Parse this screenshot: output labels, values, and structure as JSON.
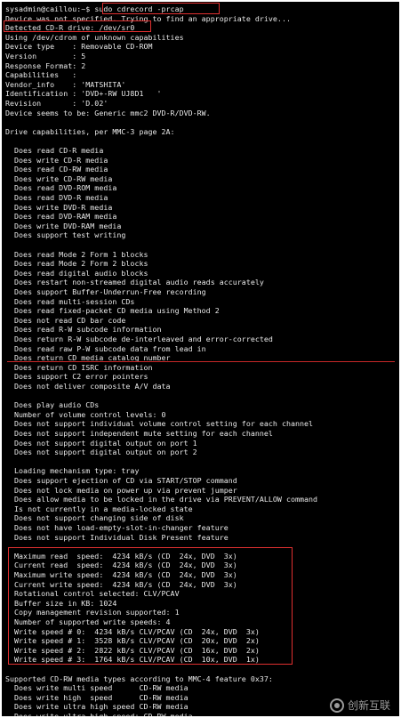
{
  "prompt": "sysadmin@caillou:~$ ",
  "command": "sudo cdrecord -prcap",
  "detected_line": "Detected CD-R drive: /dev/sr0",
  "lines": [
    "Device was not specified. Trying to find an appropriate drive...",
    "",
    "Using /dev/cdrom of unknown capabilities",
    "Device type    : Removable CD-ROM",
    "Version        : 5",
    "Response Format: 2",
    "Capabilities   :",
    "Vendor_info    : 'MATSHITA'",
    "Identification : 'DVD+-RW UJ8D1   '",
    "Revision       : 'D.02'",
    "Device seems to be: Generic mmc2 DVD-R/DVD-RW.",
    "",
    "Drive capabilities, per MMC-3 page 2A:",
    "",
    "  Does read CD-R media",
    "  Does write CD-R media",
    "  Does read CD-RW media",
    "  Does write CD-RW media",
    "  Does read DVD-ROM media",
    "  Does read DVD-R media",
    "  Does write DVD-R media",
    "  Does read DVD-RAM media",
    "  Does write DVD-RAM media",
    "  Does support test writing",
    "",
    "  Does read Mode 2 Form 1 blocks",
    "  Does read Mode 2 Form 2 blocks",
    "  Does read digital audio blocks",
    "  Does restart non-streamed digital audio reads accurately",
    "  Does support Buffer-Underrun-Free recording",
    "  Does read multi-session CDs",
    "  Does read fixed-packet CD media using Method 2",
    "  Does not read CD bar code",
    "  Does read R-W subcode information",
    "  Does return R-W subcode de-interleaved and error-corrected",
    "  Does read raw P-W subcode data from lead in",
    "  Does return CD media catalog number",
    "  Does return CD ISRC information",
    "  Does support C2 error pointers",
    "  Does not deliver composite A/V data",
    "",
    "  Does play audio CDs",
    "  Number of volume control levels: 0",
    "  Does not support individual volume control setting for each channel",
    "  Does not support independent mute setting for each channel",
    "  Does not support digital output on port 1",
    "  Does not support digital output on port 2",
    "",
    "  Loading mechanism type: tray",
    "  Does support ejection of CD via START/STOP command",
    "  Does not lock media on power up via prevent jumper",
    "  Does allow media to be locked in the drive via PREVENT/ALLOW command",
    "  Is not currently in a media-locked state",
    "  Does not support changing side of disk",
    "  Does not have load-empty-slot-in-changer feature",
    "  Does not support Individual Disk Present feature",
    "",
    "  Maximum read  speed:  4234 kB/s (CD  24x, DVD  3x)",
    "  Current read  speed:  4234 kB/s (CD  24x, DVD  3x)",
    "  Maximum write speed:  4234 kB/s (CD  24x, DVD  3x)",
    "  Current write speed:  4234 kB/s (CD  24x, DVD  3x)",
    "  Rotational control selected: CLV/PCAV",
    "  Buffer size in KB: 1024",
    "  Copy management revision supported: 1",
    "  Number of supported write speeds: 4",
    "  Write speed # 0:  4234 kB/s CLV/PCAV (CD  24x, DVD  3x)",
    "  Write speed # 1:  3528 kB/s CLV/PCAV (CD  20x, DVD  2x)",
    "  Write speed # 2:  2822 kB/s CLV/PCAV (CD  16x, DVD  2x)",
    "  Write speed # 3:  1764 kB/s CLV/PCAV (CD  10x, DVD  1x)",
    "",
    "Supported CD-RW media types according to MMC-4 feature 0x37:",
    "  Does write multi speed      CD-RW media",
    "  Does write high  speed      CD-RW media",
    "  Does write ultra high speed CD-RW media",
    "  Does write ultra high speed+ CD-RW media"
  ],
  "watermark": "创新互联",
  "colors": {
    "background": "#000000",
    "text": "#e8e8e8",
    "highlight": "#e03030"
  }
}
